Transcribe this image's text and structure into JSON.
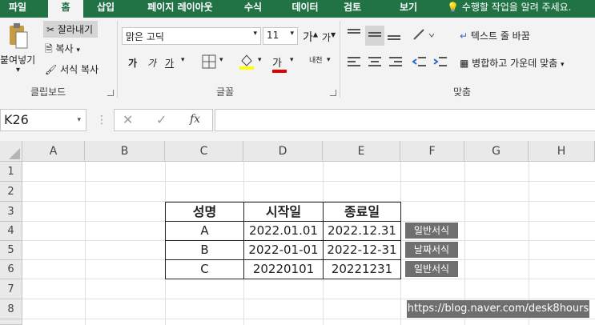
{
  "ribbon_tabs": [
    "파일",
    "홈",
    "삽입",
    "페이지 레이아웃",
    "수식",
    "데이터",
    "검토",
    "보기"
  ],
  "active_tab": "홈",
  "tell_me": "수행할 작업을 알려 주세요.",
  "clipboard": {
    "paste": "붙여넣기",
    "cut": "잘라내기",
    "copy": "복사",
    "format_painter": "서식 복사",
    "group_label": "클립보드"
  },
  "font": {
    "name": "맑은 고딕",
    "size": "11",
    "group_label": "글꼴",
    "bold": "가",
    "italic": "가",
    "underline": "가",
    "grow": "가",
    "shrink": "가",
    "font_color": "가",
    "phonetic": "내천"
  },
  "alignment": {
    "wrap_text": "텍스트 줄 바꿈",
    "merge_center": "병합하고 가운데 맞춤",
    "group_label": "맞춤"
  },
  "formula_bar": {
    "name_box": "K26",
    "fx": "fx",
    "formula": ""
  },
  "columns": [
    "A",
    "B",
    "C",
    "D",
    "E",
    "F",
    "G",
    "H"
  ],
  "rows": [
    "1",
    "2",
    "3",
    "4",
    "5",
    "6",
    "7",
    "8"
  ],
  "table": {
    "headers": [
      "성명",
      "시작일",
      "종료일"
    ],
    "rows": [
      [
        "A",
        "2022.01.01",
        "2022.12.31"
      ],
      [
        "B",
        "2022-01-01",
        "2022-12-31"
      ],
      [
        "C",
        "20220101",
        "20221231"
      ]
    ]
  },
  "tags": [
    "일반서식",
    "날짜서식",
    "일반서식"
  ],
  "watermark": "https://blog.naver.com/desk8hours",
  "colors": {
    "accent": "#217346",
    "tag_bg": "#6f6f6f"
  }
}
